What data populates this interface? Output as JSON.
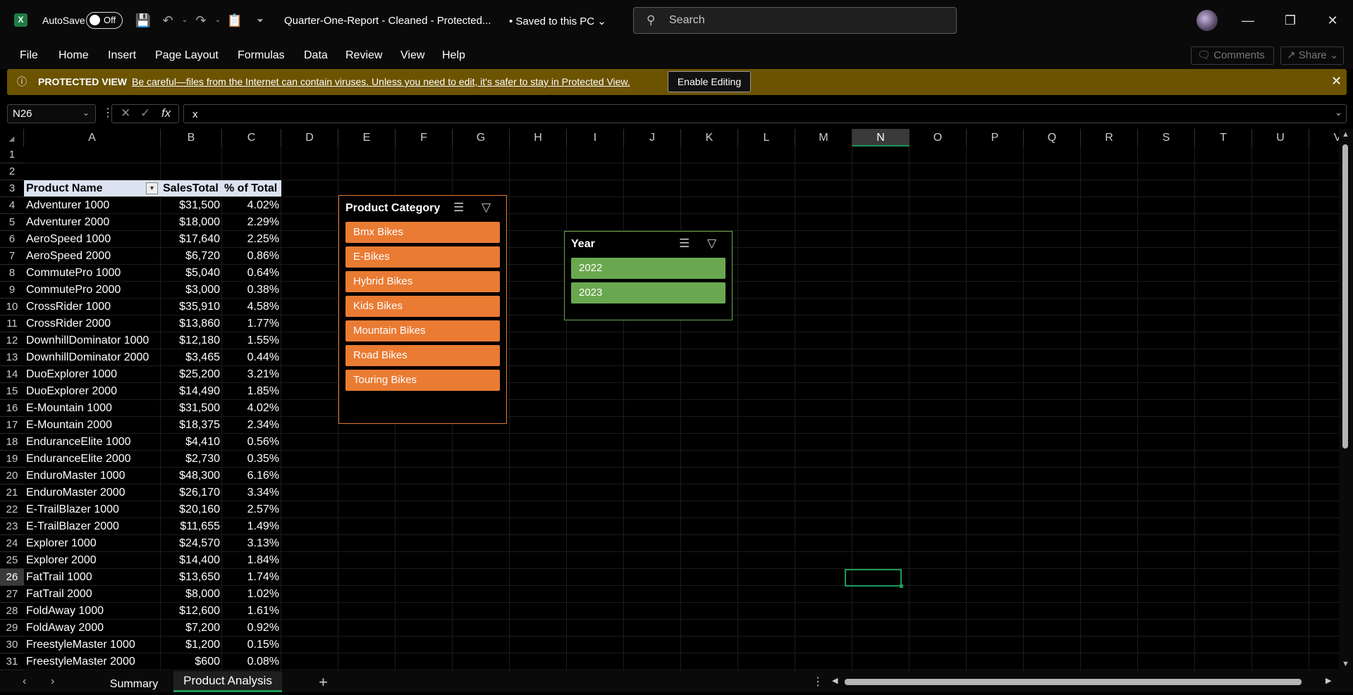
{
  "titlebar": {
    "app_icon": "X",
    "autosave_label": "AutoSave",
    "autosave_state": "Off",
    "doc_title": "Quarter-One-Report - Cleaned  -  Protected...",
    "save_status": "• Saved to this PC ⌄",
    "search_placeholder": "Search"
  },
  "menu": [
    "File",
    "Home",
    "Insert",
    "Page Layout",
    "Formulas",
    "Data",
    "Review",
    "View",
    "Help"
  ],
  "ribbon_buttons": {
    "comments": "Comments",
    "share": "Share ⌄"
  },
  "protected_view": {
    "title": "PROTECTED VIEW",
    "message": "Be careful—files from the Internet can contain viruses. Unless you need to edit, it's safer to stay in Protected View.",
    "enable_button": "Enable Editing"
  },
  "formula_bar": {
    "name_box": "N26",
    "formula": "x"
  },
  "columns": [
    "A",
    "B",
    "C",
    "D",
    "E",
    "F",
    "G",
    "H",
    "I",
    "J",
    "K",
    "L",
    "M",
    "N",
    "O",
    "P",
    "Q",
    "R",
    "S",
    "T",
    "U",
    "V"
  ],
  "selected_column": "N",
  "selected_row": "26",
  "table": {
    "headers": [
      "Product Name",
      "SalesTotal",
      "% of Total"
    ],
    "rows": [
      [
        "Adventurer 1000",
        "$31,500",
        "4.02%"
      ],
      [
        "Adventurer 2000",
        "$18,000",
        "2.29%"
      ],
      [
        "AeroSpeed 1000",
        "$17,640",
        "2.25%"
      ],
      [
        "AeroSpeed 2000",
        "$6,720",
        "0.86%"
      ],
      [
        "CommutePro 1000",
        "$5,040",
        "0.64%"
      ],
      [
        "CommutePro 2000",
        "$3,000",
        "0.38%"
      ],
      [
        "CrossRider 1000",
        "$35,910",
        "4.58%"
      ],
      [
        "CrossRider 2000",
        "$13,860",
        "1.77%"
      ],
      [
        "DownhillDominator 1000",
        "$12,180",
        "1.55%"
      ],
      [
        "DownhillDominator 2000",
        "$3,465",
        "0.44%"
      ],
      [
        "DuoExplorer 1000",
        "$25,200",
        "3.21%"
      ],
      [
        "DuoExplorer 2000",
        "$14,490",
        "1.85%"
      ],
      [
        "E-Mountain 1000",
        "$31,500",
        "4.02%"
      ],
      [
        "E-Mountain 2000",
        "$18,375",
        "2.34%"
      ],
      [
        "EnduranceElite 1000",
        "$4,410",
        "0.56%"
      ],
      [
        "EnduranceElite 2000",
        "$2,730",
        "0.35%"
      ],
      [
        "EnduroMaster 1000",
        "$48,300",
        "6.16%"
      ],
      [
        "EnduroMaster 2000",
        "$26,170",
        "3.34%"
      ],
      [
        "E-TrailBlazer 1000",
        "$20,160",
        "2.57%"
      ],
      [
        "E-TrailBlazer 2000",
        "$11,655",
        "1.49%"
      ],
      [
        "Explorer 1000",
        "$24,570",
        "3.13%"
      ],
      [
        "Explorer 2000",
        "$14,400",
        "1.84%"
      ],
      [
        "FatTrail 1000",
        "$13,650",
        "1.74%"
      ],
      [
        "FatTrail 2000",
        "$8,000",
        "1.02%"
      ],
      [
        "FoldAway 1000",
        "$12,600",
        "1.61%"
      ],
      [
        "FoldAway 2000",
        "$7,200",
        "0.92%"
      ],
      [
        "FreestyleMaster 1000",
        "$1,200",
        "0.15%"
      ],
      [
        "FreestyleMaster 2000",
        "$600",
        "0.08%"
      ]
    ]
  },
  "slicer_category": {
    "title": "Product Category",
    "items": [
      "Bmx Bikes",
      "E-Bikes",
      "Hybrid Bikes",
      "Kids Bikes",
      "Mountain Bikes",
      "Road Bikes",
      "Touring Bikes"
    ],
    "color": "#ea7b33"
  },
  "slicer_year": {
    "title": "Year",
    "items": [
      "2022",
      "2023"
    ],
    "color": "#6aa84f"
  },
  "sheets": {
    "summary": "Summary",
    "product": "Product Analysis"
  }
}
